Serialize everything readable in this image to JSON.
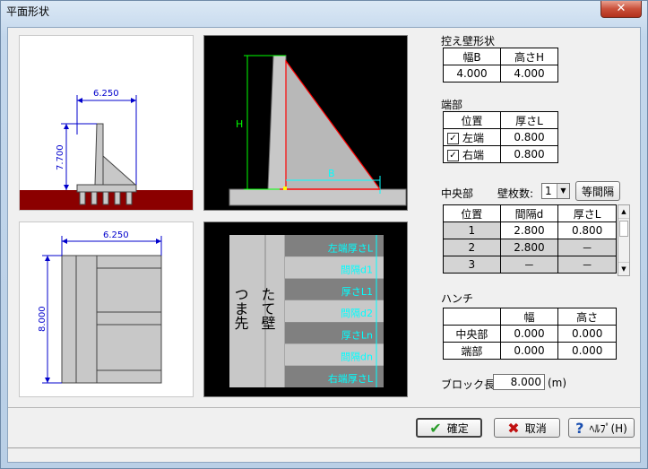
{
  "window": {
    "title": "平面形状",
    "close_glyph": "✕"
  },
  "side_view": {
    "width": "6.250",
    "height": "7.700"
  },
  "plan_view": {
    "width": "6.250",
    "length": "8.000"
  },
  "section_view": {
    "h_label": "H",
    "b_label": "B"
  },
  "wall_plan": {
    "toe_label": "つま先",
    "stem_label": "たて壁",
    "bands": [
      "左端厚さL",
      "間隔d1",
      "厚さL1",
      "間隔d2",
      "厚さLn",
      "間隔dn",
      "右端厚さL"
    ]
  },
  "counterfort": {
    "title": "控え壁形状",
    "headers": [
      "幅B",
      "高さH"
    ],
    "values": [
      "4.000",
      "4.000"
    ]
  },
  "ends": {
    "title": "端部",
    "headers": [
      "位置",
      "厚さL"
    ],
    "rows": [
      {
        "checked": "✓",
        "label": "左端",
        "value": "0.800"
      },
      {
        "checked": "✓",
        "label": "右端",
        "value": "0.800"
      }
    ]
  },
  "center": {
    "title": "中央部",
    "count_label": "壁枚数:",
    "count_value": "1",
    "equal_button": "等間隔",
    "headers": [
      "位置",
      "間隔d",
      "厚さL"
    ],
    "rows": [
      {
        "pos": "1",
        "d": "2.800",
        "l": "0.800"
      },
      {
        "pos": "2",
        "d": "2.800",
        "l": "－"
      },
      {
        "pos": "3",
        "d": "－",
        "l": "－"
      }
    ]
  },
  "haunch": {
    "title": "ハンチ",
    "headers": [
      "",
      "幅",
      "高さ"
    ],
    "rows": [
      {
        "label": "中央部",
        "w": "0.000",
        "h": "0.000"
      },
      {
        "label": "端部",
        "w": "0.000",
        "h": "0.000"
      }
    ]
  },
  "block": {
    "label": "ブロック長:",
    "value": "8.000",
    "unit": "(m)"
  },
  "buttons": {
    "ok": "確定",
    "cancel": "取消",
    "help": "ﾍﾙﾌﾟ(H)"
  },
  "colors": {
    "dim_blue": "#0000cc",
    "ground": "#8b0000",
    "cyan": "#00ffff",
    "green": "#00ff00",
    "red": "#ff0000"
  }
}
